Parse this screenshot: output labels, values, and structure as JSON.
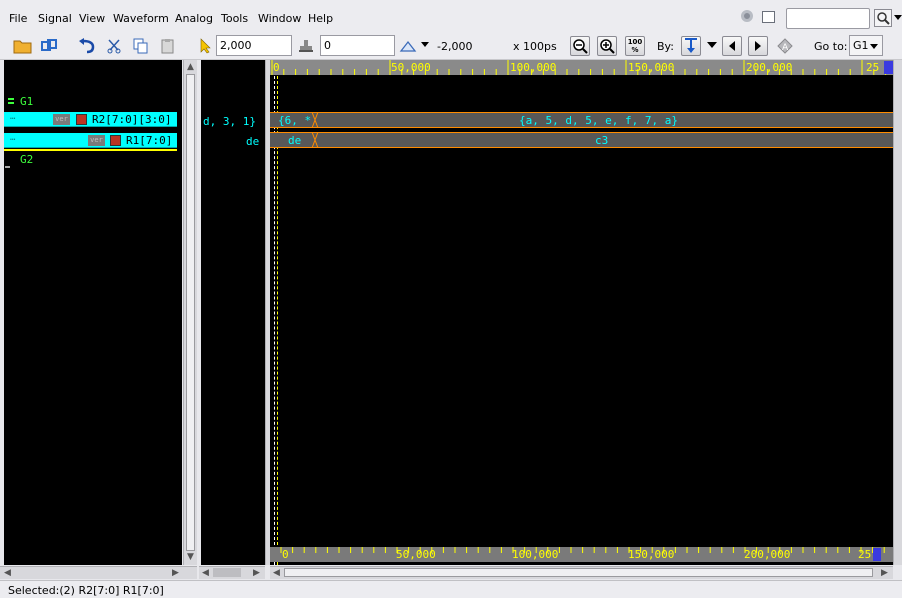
{
  "menu": [
    "File",
    "Signal",
    "View",
    "Waveform",
    "Analog",
    "Tools",
    "Window",
    "Help"
  ],
  "toolbar": {
    "cursor_time": "2,000",
    "marker_time": "0",
    "delta": "-2,000",
    "unit": "x 100ps",
    "by_label": "By:",
    "goto_label": "Go to:",
    "goto_value": "G1",
    "zoom100_label": "100 %"
  },
  "signals": {
    "group1": "G1",
    "group2": "G2",
    "row1": {
      "tag": "ver",
      "name": "R2[7:0][3:0]"
    },
    "row2": {
      "tag": "ver",
      "name": "R1[7:0]"
    }
  },
  "values": {
    "row1": "d, 3, 1}",
    "row2": "de"
  },
  "ruler": {
    "top_ticks": [
      "0",
      "50,000",
      "100,000",
      "150,000",
      "200,000",
      "25"
    ],
    "bottom_ticks": [
      "0",
      "50,000",
      "100,000",
      "150,000",
      "200,000",
      "25"
    ]
  },
  "waves": {
    "r2_first": "{6, *",
    "r2_second": "{a, 5, d, 5, e, f, 7, a}",
    "r1_first": "de",
    "r1_second": "c3"
  },
  "status": "Selected:(2)  R2[7:0] R1[7:0]",
  "colors": {
    "selection": "#00ffff",
    "group": "#3dff3d",
    "bus_edge": "#ff8c00",
    "ruler_text": "#ffff00",
    "value_text": "#00ffff"
  }
}
